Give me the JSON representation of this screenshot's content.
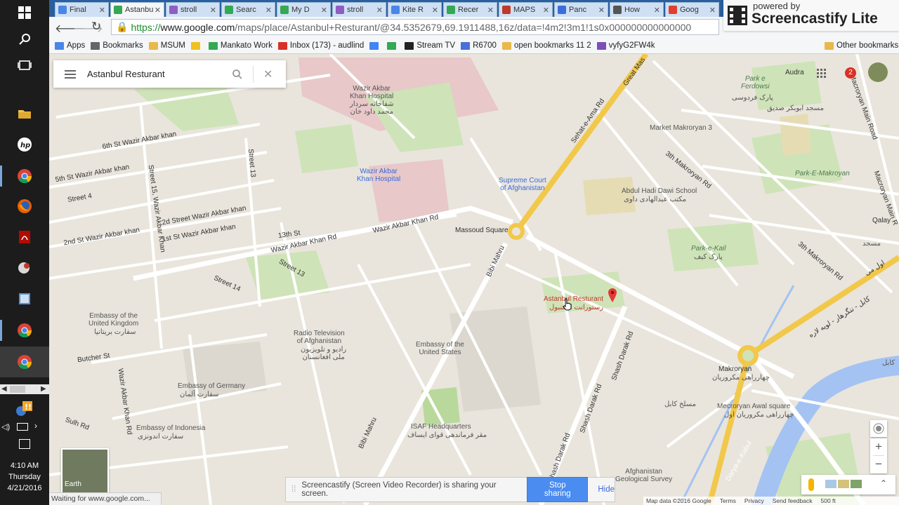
{
  "taskbar": {
    "time": "4:10 AM",
    "day": "Thursday",
    "date": "4/21/2016"
  },
  "tabs": [
    {
      "label": "Final",
      "color": "#4a86e8"
    },
    {
      "label": "Astanbu",
      "color": "#34a853"
    },
    {
      "label": "stroll",
      "color": "#8e5ec2"
    },
    {
      "label": "Searc",
      "color": "#34a853"
    },
    {
      "label": "My D",
      "color": "#34a853"
    },
    {
      "label": "stroll",
      "color": "#8e5ec2"
    },
    {
      "label": "Kite R",
      "color": "#4a86e8"
    },
    {
      "label": "Recer",
      "color": "#34a853"
    },
    {
      "label": "MAPS",
      "color": "#c0392b"
    },
    {
      "label": "Panc",
      "color": "#3b6fd8"
    },
    {
      "label": "How",
      "color": "#555555"
    },
    {
      "label": "Goog",
      "color": "#e23e2e"
    }
  ],
  "address": {
    "scheme": "https://",
    "host": "www.google.com",
    "path": "/maps/place/Astanbul+Resturant/@34.5352679,69.1911488,16z/data=!4m2!3m1!1s0x000000000000000"
  },
  "bookmarks": [
    {
      "label": "Apps",
      "color": "#4a86e8"
    },
    {
      "label": "Bookmarks",
      "color": "#666666"
    },
    {
      "label": "MSUM",
      "color": "#e8b84a"
    },
    {
      "label": "",
      "color": "#f0c020"
    },
    {
      "label": "Mankato Work",
      "color": "#34a853"
    },
    {
      "label": "Inbox (173) - audlind",
      "color": "#d93025"
    },
    {
      "label": "",
      "color": "#4285f4"
    },
    {
      "label": "",
      "color": "#34a853"
    },
    {
      "label": "Stream TV",
      "color": "#222222"
    },
    {
      "label": "R6700",
      "color": "#4a6fd8"
    },
    {
      "label": "open bookmarks 11 2",
      "color": "#e8b84a"
    },
    {
      "label": "vyfyG2FW4k",
      "color": "#7b4fb5"
    }
  ],
  "other_bookmarks": "Other bookmarks",
  "search": {
    "value": "Astanbul Resturant"
  },
  "screencastify": {
    "powered": "powered by",
    "name": "Screencastify Lite",
    "share_message": "Screencastify (Screen Video Recorder) is sharing your screen.",
    "stop_label": "Stop sharing",
    "hide_label": "Hide"
  },
  "status": "Waiting for www.google.com...",
  "map": {
    "streets": {
      "s6th": "6th St Wazir Akbar khan",
      "s5th": "5th St Wazir Akbar khan",
      "street4": "Street 4",
      "s2nd_a": "2d Street Wazir Akbar khan",
      "s2nd_b": "2nd St Wazir Akbar khan",
      "s1st": "1st St Wazir Akbar khan",
      "s13th": "13th St",
      "wak_rd1": "Wazir Akbar Khan Rd",
      "wak_rd2": "Wazir Akbar Khan Rd",
      "street13a": "Street 13",
      "street13b": "Street 13",
      "street15": "Street 15, Wazir Akbar Khan",
      "street14": "Street 14",
      "butcher": "Butcher St",
      "sulh": "Sulh Rd",
      "wak_vert": "Wazir Akbar Khan Rd",
      "bibi1": "Bibi Mahru",
      "bibi2": "Bibi Mahru",
      "shash1": "Shash Darak Rd",
      "shash2": "Shash Darak Rd",
      "shash3": "Shash Darak Rd",
      "sehat": "Sehat-e-Ama Rd",
      "greatmas": "Great Mas",
      "makr3a": "3th Makroryan Rd",
      "makr3b": "3th Makroryan Rd",
      "makr_main": "Macroryan Main Road",
      "makr_main2": "Macroryan Main R",
      "darya": "Darya-e-Kabul",
      "kabul_jalal": "کابل - ننگرهار - لویه لاره",
      "awal_mai": "اول می"
    },
    "places": {
      "wak_hospital": "Wazir Akbar\nKhan Hospital",
      "wak_hospital_fa": "شفاخانه سردار\nمحمد داود خان",
      "wak_hospital2": "Wazir Akbar\nKhan Hospital",
      "supreme": "Supreme Court\nof Afghanistan",
      "massoud": "Massoud Square",
      "abdul": "Abdul Hadi Dawi School",
      "abdul_fa": "مکتب عبدالهادی داوی",
      "market": "Market Makroryan 3",
      "parke_ferdowsi": "Park e\nFerdowsi",
      "parke_ferdowsi_fa": "پارک فردوسی",
      "masjid": "مسجد ابوبکر صدیق",
      "parke_makroyan": "Park-E-Makroyan",
      "parke_kail": "Park-e-Kail",
      "parke_kail_fa": "پارک کیف",
      "qalay": "Qalay",
      "masjid2": "مسجد",
      "audra": "Audra",
      "uk": "Embassy of the\nUnited Kingdom",
      "uk_fa": "سفارت بریتانیا",
      "rta": "Radio Television\nof Afghanistan",
      "rta_fa": "رادیو و تلویزیون\nملی افغانستان",
      "us": "Embassy of the\nUnited States",
      "restaurant": "Astanbul Resturant",
      "restaurant_fa": "رستورانت استنبول",
      "germany": "Embassy of Germany",
      "germany_fa": "سفارت آلمان",
      "indonesia": "Embassy of Indonesia",
      "indonesia_fa": "سفارت اندونزی",
      "isaf": "ISAF Headquarters",
      "isaf_fa": "مقر فرماندهی قوای ایساف",
      "makroryan": "Makroryan",
      "makroryan_fa": "چهارراهی مکروریان",
      "masjid_kabul": "مسلخ کابل",
      "mecroryan_awal": "Mecroryan Awal square",
      "mecroryan_awal_fa": "چهارراهی مکروریان اول",
      "afg_geo": "Afghanistan\nGeological Survey",
      "kabul_fa": "کابل"
    },
    "earth": "Earth",
    "zoom_in": "+",
    "zoom_out": "−",
    "notif_count": "2",
    "footer": {
      "data": "Map data ©2016 Google",
      "terms": "Terms",
      "privacy": "Privacy",
      "feedback": "Send feedback",
      "scale": "500 ft"
    }
  }
}
